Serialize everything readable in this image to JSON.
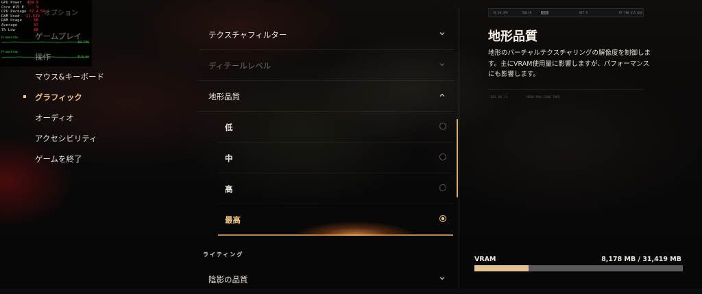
{
  "overlay": {
    "rows": [
      {
        "k": "GPU Power",
        "v": "459.9",
        "v2": ""
      },
      {
        "k": "Core #15 E",
        "v": "9",
        "v2": ""
      },
      {
        "k": "CPU Package",
        "v": "57.4",
        "v2": "59"
      },
      {
        "k": "RAM Used",
        "v": "11,619",
        "v2": ""
      },
      {
        "k": "RAM Usage",
        "v": "50",
        "v2": ""
      },
      {
        "k": "Average",
        "v": "97",
        "v2": ""
      },
      {
        "k": "1% Low",
        "v": "68",
        "v2": ""
      }
    ],
    "graph1_left": "Framerate",
    "graph1_right": "82 FPS",
    "graph2_left": "Frametime",
    "graph2_right": "9.8 ms"
  },
  "menu": {
    "title": "オプション",
    "items": [
      {
        "label": "ゲームプレイ",
        "state": "dim"
      },
      {
        "label": "操作",
        "state": "dim"
      },
      {
        "label": "マウス&キーボード",
        "state": "normal"
      },
      {
        "label": "グラフィック",
        "state": "active"
      },
      {
        "label": "オーディオ",
        "state": "normal"
      },
      {
        "label": "アクセシビリティ",
        "state": "normal"
      },
      {
        "label": "ゲームを終了",
        "state": "normal"
      }
    ]
  },
  "settings": {
    "rows": [
      {
        "label": "テクスチャフィルター",
        "state": "normal",
        "chevron": "down"
      },
      {
        "label": "ディテールレベル",
        "state": "dim",
        "chevron": "down"
      },
      {
        "label": "地形品質",
        "state": "expanded",
        "chevron": "up"
      }
    ],
    "options": [
      {
        "label": "低",
        "selected": false
      },
      {
        "label": "中",
        "selected": false
      },
      {
        "label": "高",
        "selected": false
      },
      {
        "label": "最高",
        "selected": true
      }
    ],
    "section": "ライティング",
    "after_section": {
      "label": "陰影の品質",
      "chevron": "down"
    }
  },
  "description": {
    "title": "地形品質",
    "body": "地形のバーチャルテクスチャリングの解像度を制御します。主にVRAM使用量に影響しますが、パフォーマンスにも影響します。"
  },
  "vram": {
    "label": "VRAM",
    "value": "8,178 MB / 31,419 MB",
    "used_fraction": 0.26
  },
  "colors": {
    "accent": "#f2c785",
    "vram_fill": "#e3c38f",
    "overlay_red": "#ff3a3a",
    "overlay_green": "#3cd23c"
  }
}
